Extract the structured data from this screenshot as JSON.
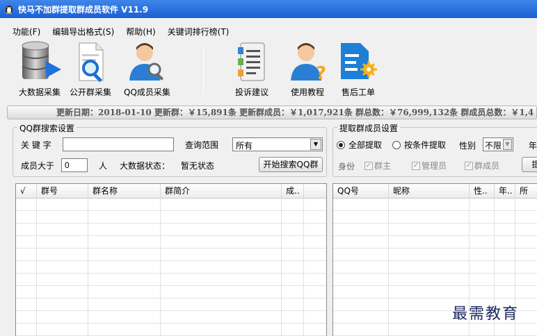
{
  "window": {
    "title": "快马不加群提取群成员软件  V11.9"
  },
  "menu": [
    {
      "label": "功能(F)"
    },
    {
      "label": "编辑导出格式(S)"
    },
    {
      "label": "帮助(H)"
    },
    {
      "label": "关键词排行榜(T)"
    }
  ],
  "toolbar": {
    "items": [
      {
        "label": "大数据采集",
        "icon": "database-icon"
      },
      {
        "label": "公开群采集",
        "icon": "document-search-icon"
      },
      {
        "label": "QQ成员采集",
        "icon": "user-search-icon"
      },
      {
        "label": "投诉建议",
        "icon": "notebook-icon"
      },
      {
        "label": "使用教程",
        "icon": "user-help-icon"
      },
      {
        "label": "售后工单",
        "icon": "ticket-gear-icon"
      }
    ]
  },
  "info_bar": {
    "text": "更新日期：2018-01-10 更新群：￥15,891条 更新群成员：￥1,017,921条 群总数：￥76,999,132条 群成员总数：￥1,4"
  },
  "search_group": {
    "legend": "QQ群搜索设置",
    "keyword_label": "关 键 字",
    "keyword_value": "",
    "scope_label": "查询范围",
    "scope_value": "所有",
    "members_label": "成员大于",
    "members_value": "0",
    "members_unit": "人",
    "status_label": "大数据状态：",
    "status_value": "暂无状态",
    "search_button": "开始搜索QQ群"
  },
  "extract_group": {
    "legend": "提取群成员设置",
    "radio_all": "全部提取",
    "radio_cond": "按条件提取",
    "gender_label": "性别",
    "gender_value": "不限",
    "age_label": "年",
    "identity_label": "身份",
    "check_owner": "群主",
    "check_admin": "管理员",
    "check_member": "群成员",
    "extract_button": "提"
  },
  "group_table": {
    "columns": [
      "√",
      "群号",
      "群名称",
      "群简介",
      "成.."
    ]
  },
  "member_table": {
    "columns": [
      "QQ号",
      "昵称",
      "性..",
      "年..",
      "所"
    ]
  },
  "watermark": "最需教育",
  "colors": {
    "titlebar": "#2a6fe0",
    "doc_blue": "#1e7fd6"
  }
}
